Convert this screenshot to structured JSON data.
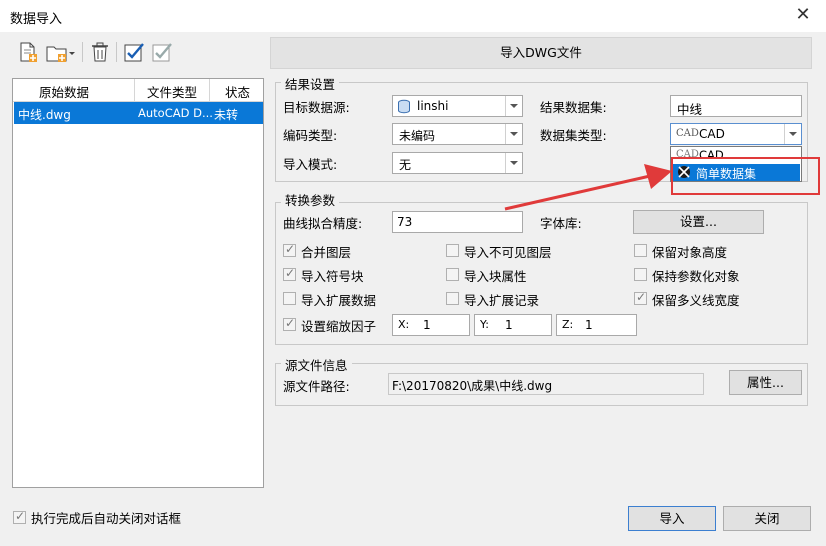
{
  "window": {
    "title": "数据导入",
    "close_icon": "close-icon"
  },
  "toolbar": {
    "icons": [
      "add-file-icon",
      "add-folder-icon",
      "delete-icon",
      "select-all-icon",
      "invert-select-icon"
    ]
  },
  "file_list": {
    "columns": [
      "原始数据",
      "文件类型",
      "状态"
    ],
    "rows": [
      {
        "name": "中线.dwg",
        "type": "AutoCAD D...",
        "status": "未转"
      }
    ]
  },
  "banner": "导入DWG文件",
  "result_settings": {
    "title": "结果设置",
    "target_label": "目标数据源:",
    "target_value": "linshi",
    "encoding_label": "编码类型:",
    "encoding_value": "未编码",
    "mode_label": "导入模式:",
    "mode_value": "无",
    "dataset_label": "结果数据集:",
    "dataset_value": "中线",
    "dataset_type_label": "数据集类型:",
    "dataset_type_value": "CAD",
    "dataset_type_options": [
      "CAD",
      "简单数据集"
    ],
    "highlighted_option": "简单数据集"
  },
  "convert": {
    "title": "转换参数",
    "precision_label": "曲线拟合精度:",
    "precision_value": "73",
    "font_label": "字体库:",
    "font_button": "设置...",
    "checkboxes": [
      {
        "label": "合并图层",
        "checked": true
      },
      {
        "label": "导入不可见图层",
        "checked": false
      },
      {
        "label": "保留对象高度",
        "checked": false
      },
      {
        "label": "导入符号块",
        "checked": true
      },
      {
        "label": "导入块属性",
        "checked": false
      },
      {
        "label": "保持参数化对象",
        "checked": false
      },
      {
        "label": "导入扩展数据",
        "checked": false
      },
      {
        "label": "导入扩展记录",
        "checked": false
      },
      {
        "label": "保留多义线宽度",
        "checked": true
      }
    ],
    "scale_label": "设置缩放因子",
    "scale_checked": true,
    "x_label": "X:",
    "x_value": "1",
    "y_label": "Y:",
    "y_value": "1",
    "z_label": "Z:",
    "z_value": "1"
  },
  "source": {
    "title": "源文件信息",
    "path_label": "源文件路径:",
    "path_value": "F:\\20170820\\成果\\中线.dwg",
    "props_button": "属性..."
  },
  "footer": {
    "auto_close_label": "执行完成后自动关闭对话框",
    "auto_close_checked": true,
    "import_button": "导入",
    "close_button": "关闭"
  },
  "colors": {
    "selection": "#0a78d7",
    "annotation": "#e03a3a",
    "window_bg": "#f0f0f0"
  }
}
